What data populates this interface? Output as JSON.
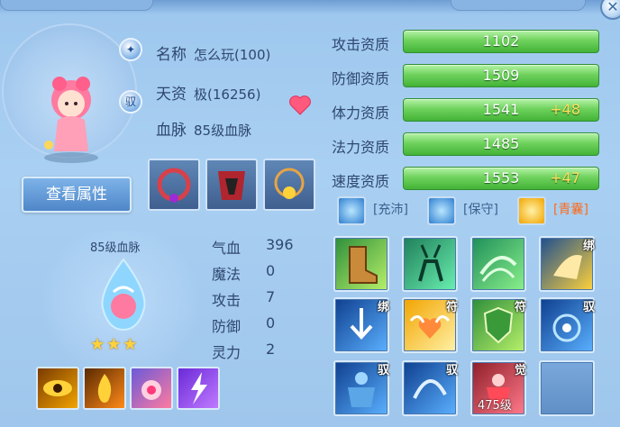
{
  "pet": {
    "name_label": "名称",
    "name_value": "怎么玩(100)",
    "aptitude_label": "天资",
    "aptitude_value": "极(16256)",
    "bloodline_label": "血脉",
    "bloodline_value": "85级血脉",
    "view_attr_button": "查看属性",
    "mount_icon_char": "驭"
  },
  "bloodline_panel": {
    "title": "85级血脉",
    "stars": "★★★",
    "stats": [
      {
        "label": "气血",
        "value": "396"
      },
      {
        "label": "魔法",
        "value": "0"
      },
      {
        "label": "攻击",
        "value": "7"
      },
      {
        "label": "防御",
        "value": "0"
      },
      {
        "label": "灵力",
        "value": "2"
      }
    ]
  },
  "resources": [
    {
      "label": "攻击资质",
      "value": "1102",
      "plus": ""
    },
    {
      "label": "防御资质",
      "value": "1509",
      "plus": ""
    },
    {
      "label": "体力资质",
      "value": "1541",
      "plus": "+48"
    },
    {
      "label": "法力资质",
      "value": "1485",
      "plus": ""
    },
    {
      "label": "速度资质",
      "value": "1553",
      "plus": "+47"
    }
  ],
  "badges": [
    {
      "text": "[充沛]",
      "color": "#3f5f8f",
      "icon": "abundant-icon"
    },
    {
      "text": "[保守]",
      "color": "#3f5f8f",
      "icon": "conservative-icon"
    },
    {
      "text": "[青囊]",
      "color": "#ff6a1a",
      "icon": "qingnang-icon"
    }
  ],
  "skills": [
    {
      "tag": "",
      "level": "",
      "icon": "boot-skill-icon"
    },
    {
      "tag": "",
      "level": "",
      "icon": "deer-skill-icon"
    },
    {
      "tag": "",
      "level": "",
      "icon": "wind-skill-icon"
    },
    {
      "tag": "绑",
      "level": "",
      "icon": "scroll-skill-icon"
    },
    {
      "tag": "绑",
      "level": "",
      "icon": "arrow-down-skill-icon"
    },
    {
      "tag": "符",
      "level": "",
      "icon": "heart-wing-skill-icon"
    },
    {
      "tag": "符",
      "level": "",
      "icon": "shield-skill-icon"
    },
    {
      "tag": "驭",
      "level": "",
      "icon": "spirit-skill-icon"
    },
    {
      "tag": "驭",
      "level": "",
      "icon": "muscle-skill-icon"
    },
    {
      "tag": "驭",
      "level": "",
      "icon": "swirl-skill-icon"
    },
    {
      "tag": "觉",
      "level": "475级",
      "icon": "awaken-skill-icon"
    },
    {
      "tag": "",
      "level": "",
      "icon": "empty-slot"
    }
  ],
  "colors": {
    "bar_green": "#43b337",
    "plus_yellow": "#ffe05c",
    "star_gold": "#ffd23a"
  }
}
